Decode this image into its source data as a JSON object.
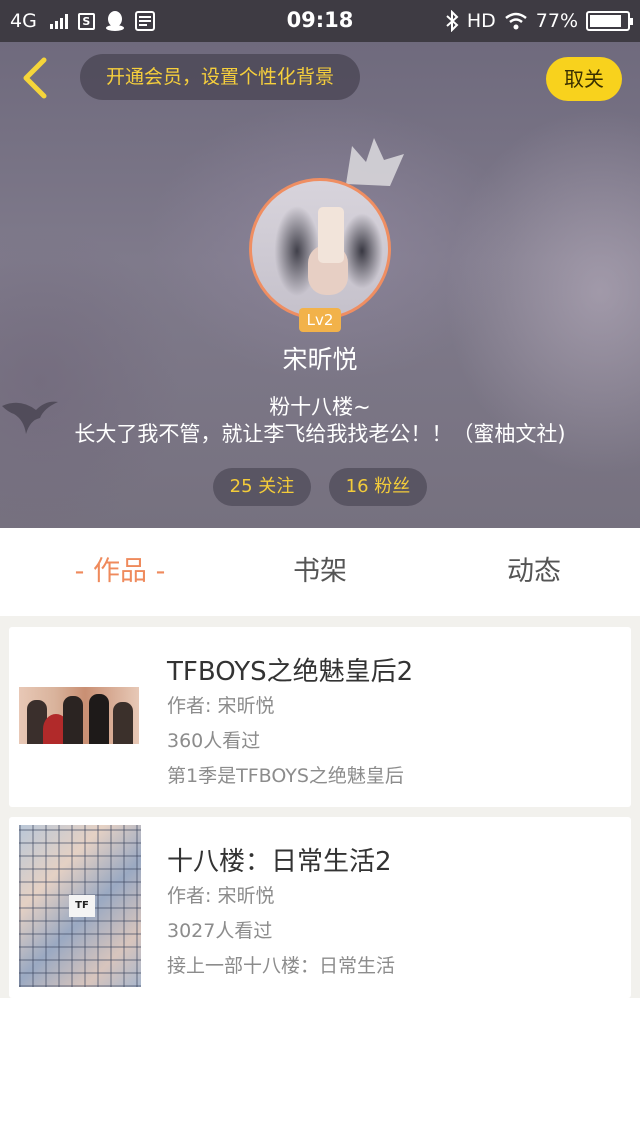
{
  "status_bar": {
    "network": "4G",
    "time": "09:18",
    "hd": "HD",
    "battery": "77%",
    "sim_icon_letter": "S"
  },
  "header": {
    "vip_prompt": "开通会员，设置个性化背景",
    "unfollow_label": "取关",
    "level": "Lv2",
    "username": "宋昕悦",
    "bio_line1": "粉十八楼~",
    "bio_line2": "长大了我不管，就让李飞给我找老公！！（蜜柚文社)",
    "following": "25 关注",
    "fans": "16 粉丝"
  },
  "tabs": {
    "works": "- 作品 -",
    "bookshelf": "书架",
    "activity": "动态"
  },
  "works": [
    {
      "title": "TFBOYS之绝魅皇后2",
      "author": "作者: 宋昕悦",
      "views": "360人看过",
      "desc": "第1季是TFBOYS之绝魅皇后"
    },
    {
      "title": "十八楼：日常生活2",
      "author": "作者: 宋昕悦",
      "views": "3027人看过",
      "desc": "接上一部十八楼：日常生活"
    }
  ],
  "colors": {
    "accent_yellow": "#f8d21d",
    "vip_text": "#f6cf3c",
    "active_tab": "#ef8a5c",
    "avatar_ring": "#ef8e62",
    "level_badge": "#f2b24a"
  },
  "icons": {
    "back": "chevron-left-icon",
    "crown": "crown-icon",
    "bird": "swallow-icon",
    "bluetooth": "bluetooth-icon",
    "wifi": "wifi-icon",
    "battery": "battery-icon",
    "qq": "qq-penguin-icon"
  }
}
